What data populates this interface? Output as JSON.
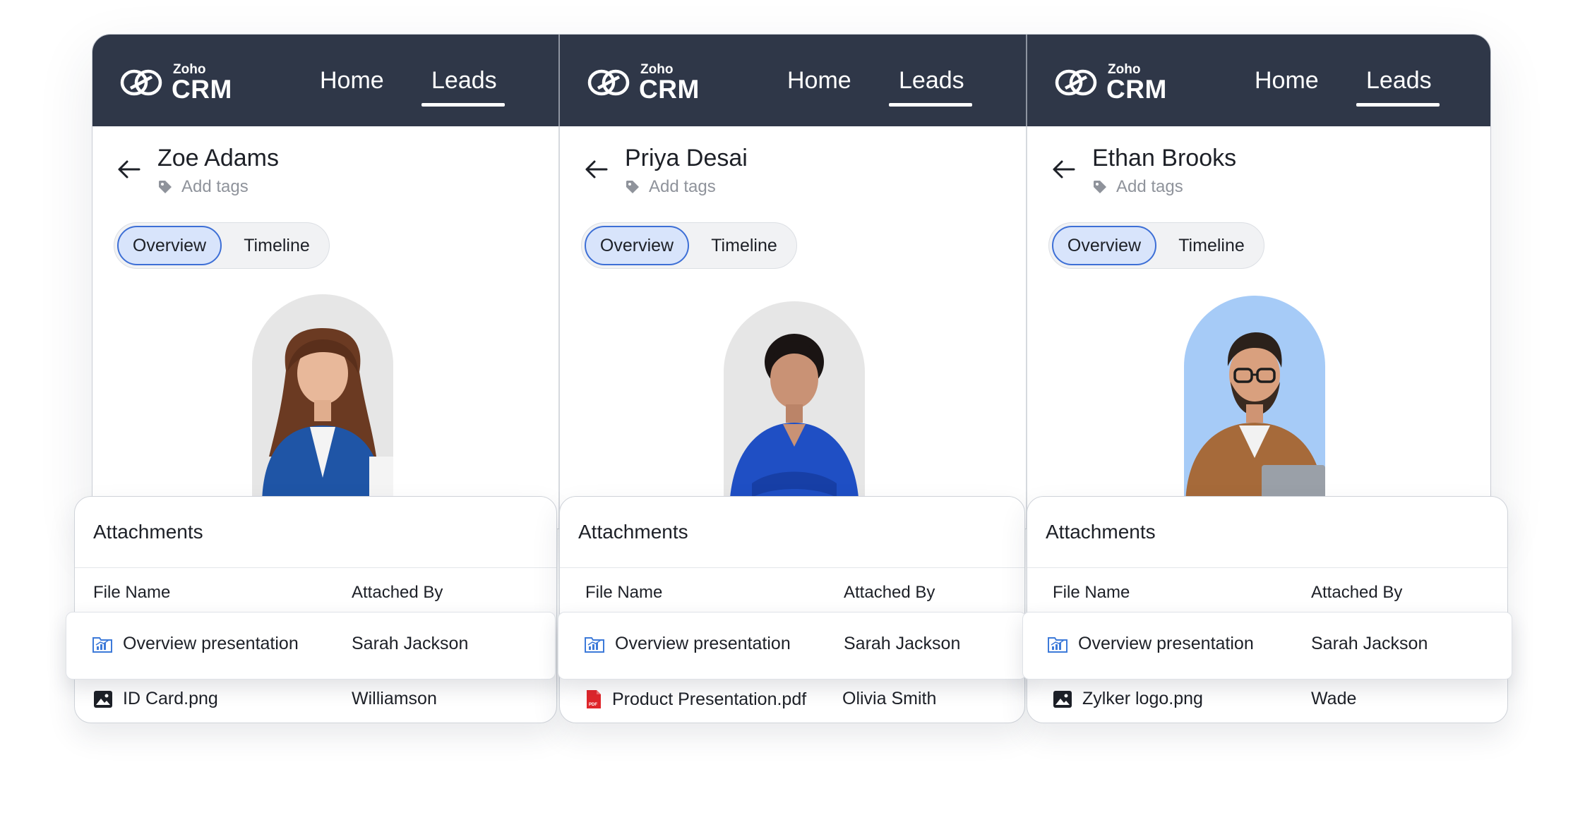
{
  "app": {
    "logo_small": "Zoho",
    "logo_big": "CRM"
  },
  "nav": {
    "home": "Home",
    "leads": "Leads",
    "active": "Leads"
  },
  "tabs": {
    "overview": "Overview",
    "timeline": "Timeline",
    "active": "Overview"
  },
  "tags_placeholder": "Add tags",
  "attachments": {
    "title": "Attachments",
    "col_file": "File Name",
    "col_by": "Attached By"
  },
  "panels": [
    {
      "name": "Zoe Adams",
      "portrait_bg": "#e6e6e6",
      "highlight_row": {
        "file": "Overview presentation",
        "by": "Sarah Jackson",
        "icon": "presentation-icon"
      },
      "row": {
        "file": "ID Card.png",
        "by": "Williamson",
        "icon": "image-icon"
      }
    },
    {
      "name": "Priya Desai",
      "portrait_bg": "#e6e6e6",
      "highlight_row": {
        "file": "Overview presentation",
        "by": "Sarah Jackson",
        "icon": "presentation-icon"
      },
      "row": {
        "file": "Product Presentation.pdf",
        "by": "Olivia Smith",
        "icon": "pdf-icon"
      }
    },
    {
      "name": "Ethan Brooks",
      "portrait_bg": "#a6cbf7",
      "highlight_row": {
        "file": "Overview presentation",
        "by": "Sarah Jackson",
        "icon": "presentation-icon"
      },
      "row": {
        "file": "Zylker logo.png",
        "by": "Wade",
        "icon": "image-icon"
      }
    }
  ],
  "colors": {
    "navbar": "#2f3748",
    "accent": "#3d6fd6",
    "tab_active_bg": "#d8e4fb",
    "pdf_red": "#e0262b"
  }
}
